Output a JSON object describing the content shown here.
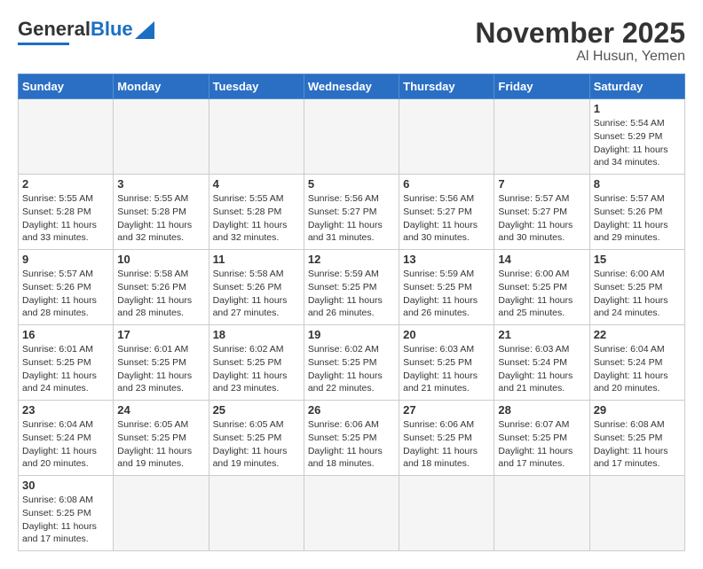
{
  "header": {
    "logo_general": "General",
    "logo_blue": "Blue",
    "month_title": "November 2025",
    "location": "Al Husun, Yemen"
  },
  "days_of_week": [
    "Sunday",
    "Monday",
    "Tuesday",
    "Wednesday",
    "Thursday",
    "Friday",
    "Saturday"
  ],
  "weeks": [
    [
      {
        "day": "",
        "info": ""
      },
      {
        "day": "",
        "info": ""
      },
      {
        "day": "",
        "info": ""
      },
      {
        "day": "",
        "info": ""
      },
      {
        "day": "",
        "info": ""
      },
      {
        "day": "",
        "info": ""
      },
      {
        "day": "1",
        "info": "Sunrise: 5:54 AM\nSunset: 5:29 PM\nDaylight: 11 hours\nand 34 minutes."
      }
    ],
    [
      {
        "day": "2",
        "info": "Sunrise: 5:55 AM\nSunset: 5:28 PM\nDaylight: 11 hours\nand 33 minutes."
      },
      {
        "day": "3",
        "info": "Sunrise: 5:55 AM\nSunset: 5:28 PM\nDaylight: 11 hours\nand 32 minutes."
      },
      {
        "day": "4",
        "info": "Sunrise: 5:55 AM\nSunset: 5:28 PM\nDaylight: 11 hours\nand 32 minutes."
      },
      {
        "day": "5",
        "info": "Sunrise: 5:56 AM\nSunset: 5:27 PM\nDaylight: 11 hours\nand 31 minutes."
      },
      {
        "day": "6",
        "info": "Sunrise: 5:56 AM\nSunset: 5:27 PM\nDaylight: 11 hours\nand 30 minutes."
      },
      {
        "day": "7",
        "info": "Sunrise: 5:57 AM\nSunset: 5:27 PM\nDaylight: 11 hours\nand 30 minutes."
      },
      {
        "day": "8",
        "info": "Sunrise: 5:57 AM\nSunset: 5:26 PM\nDaylight: 11 hours\nand 29 minutes."
      }
    ],
    [
      {
        "day": "9",
        "info": "Sunrise: 5:57 AM\nSunset: 5:26 PM\nDaylight: 11 hours\nand 28 minutes."
      },
      {
        "day": "10",
        "info": "Sunrise: 5:58 AM\nSunset: 5:26 PM\nDaylight: 11 hours\nand 28 minutes."
      },
      {
        "day": "11",
        "info": "Sunrise: 5:58 AM\nSunset: 5:26 PM\nDaylight: 11 hours\nand 27 minutes."
      },
      {
        "day": "12",
        "info": "Sunrise: 5:59 AM\nSunset: 5:25 PM\nDaylight: 11 hours\nand 26 minutes."
      },
      {
        "day": "13",
        "info": "Sunrise: 5:59 AM\nSunset: 5:25 PM\nDaylight: 11 hours\nand 26 minutes."
      },
      {
        "day": "14",
        "info": "Sunrise: 6:00 AM\nSunset: 5:25 PM\nDaylight: 11 hours\nand 25 minutes."
      },
      {
        "day": "15",
        "info": "Sunrise: 6:00 AM\nSunset: 5:25 PM\nDaylight: 11 hours\nand 24 minutes."
      }
    ],
    [
      {
        "day": "16",
        "info": "Sunrise: 6:01 AM\nSunset: 5:25 PM\nDaylight: 11 hours\nand 24 minutes."
      },
      {
        "day": "17",
        "info": "Sunrise: 6:01 AM\nSunset: 5:25 PM\nDaylight: 11 hours\nand 23 minutes."
      },
      {
        "day": "18",
        "info": "Sunrise: 6:02 AM\nSunset: 5:25 PM\nDaylight: 11 hours\nand 23 minutes."
      },
      {
        "day": "19",
        "info": "Sunrise: 6:02 AM\nSunset: 5:25 PM\nDaylight: 11 hours\nand 22 minutes."
      },
      {
        "day": "20",
        "info": "Sunrise: 6:03 AM\nSunset: 5:25 PM\nDaylight: 11 hours\nand 21 minutes."
      },
      {
        "day": "21",
        "info": "Sunrise: 6:03 AM\nSunset: 5:24 PM\nDaylight: 11 hours\nand 21 minutes."
      },
      {
        "day": "22",
        "info": "Sunrise: 6:04 AM\nSunset: 5:24 PM\nDaylight: 11 hours\nand 20 minutes."
      }
    ],
    [
      {
        "day": "23",
        "info": "Sunrise: 6:04 AM\nSunset: 5:24 PM\nDaylight: 11 hours\nand 20 minutes."
      },
      {
        "day": "24",
        "info": "Sunrise: 6:05 AM\nSunset: 5:25 PM\nDaylight: 11 hours\nand 19 minutes."
      },
      {
        "day": "25",
        "info": "Sunrise: 6:05 AM\nSunset: 5:25 PM\nDaylight: 11 hours\nand 19 minutes."
      },
      {
        "day": "26",
        "info": "Sunrise: 6:06 AM\nSunset: 5:25 PM\nDaylight: 11 hours\nand 18 minutes."
      },
      {
        "day": "27",
        "info": "Sunrise: 6:06 AM\nSunset: 5:25 PM\nDaylight: 11 hours\nand 18 minutes."
      },
      {
        "day": "28",
        "info": "Sunrise: 6:07 AM\nSunset: 5:25 PM\nDaylight: 11 hours\nand 17 minutes."
      },
      {
        "day": "29",
        "info": "Sunrise: 6:08 AM\nSunset: 5:25 PM\nDaylight: 11 hours\nand 17 minutes."
      }
    ],
    [
      {
        "day": "30",
        "info": "Sunrise: 6:08 AM\nSunset: 5:25 PM\nDaylight: 11 hours\nand 17 minutes."
      },
      {
        "day": "",
        "info": ""
      },
      {
        "day": "",
        "info": ""
      },
      {
        "day": "",
        "info": ""
      },
      {
        "day": "",
        "info": ""
      },
      {
        "day": "",
        "info": ""
      },
      {
        "day": "",
        "info": ""
      }
    ]
  ]
}
